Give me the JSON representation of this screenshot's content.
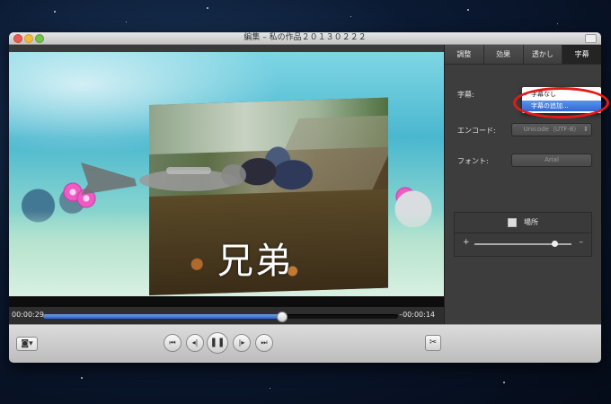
{
  "window": {
    "title": "編集 – 私の作品２０１３０２２２"
  },
  "video": {
    "overlay_text": "兄弟"
  },
  "timeline": {
    "elapsed": "00:00:29",
    "remaining": "–00:00:14",
    "progress": 0.67
  },
  "tabs": [
    {
      "label": "調整"
    },
    {
      "label": "効果"
    },
    {
      "label": "透かし"
    },
    {
      "label": "字幕",
      "active": true
    }
  ],
  "subtitle": {
    "label": "字幕:",
    "dropdown_items": [
      {
        "label": "字幕なし",
        "checked": true
      },
      {
        "label": "字幕の追加...",
        "highlighted": true
      }
    ],
    "encode_label": "エンコード:",
    "encode_value": "Unicode（UTF-8）",
    "font_label": "フォント:",
    "font_value": "Arial",
    "place_label": "場所",
    "place_plus": "+",
    "place_minus": "–",
    "place_level": 0.82
  },
  "controls": [
    "camera-icon",
    "skip-back-icon",
    "step-back-icon",
    "pause-icon",
    "step-forward-icon",
    "skip-forward-icon",
    "cut-icon"
  ],
  "annotation_color": "#e41a1a"
}
